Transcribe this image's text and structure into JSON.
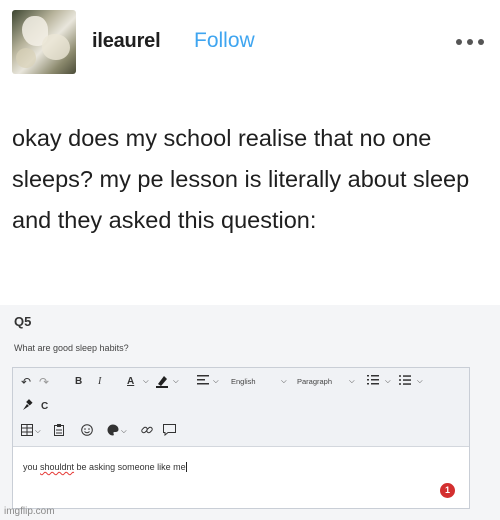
{
  "post": {
    "author": "ileaurel",
    "follow_label": "Follow",
    "text": "okay does my school realise that no one sleeps? my pe lesson is literally about sleep and they asked this question:"
  },
  "screenshot": {
    "question_number": "Q5",
    "question_text": "What are good sleep habits?",
    "toolbar": {
      "undo_icon": "↶",
      "redo_icon": "↷",
      "bold": "B",
      "italic": "I",
      "text_color": "A",
      "chevron": "⌵",
      "language_value": "English",
      "paragraph_value": "Paragraph",
      "clear_format": "C"
    },
    "answer_before": "you ",
    "answer_misspelled": "shouldnt",
    "answer_after": " be asking someone like me",
    "error_count": "1"
  },
  "watermark": "imgflip.com",
  "colors": {
    "follow": "#3fa5f0",
    "badge": "#d32f2f",
    "text": "#1f1f1f"
  }
}
